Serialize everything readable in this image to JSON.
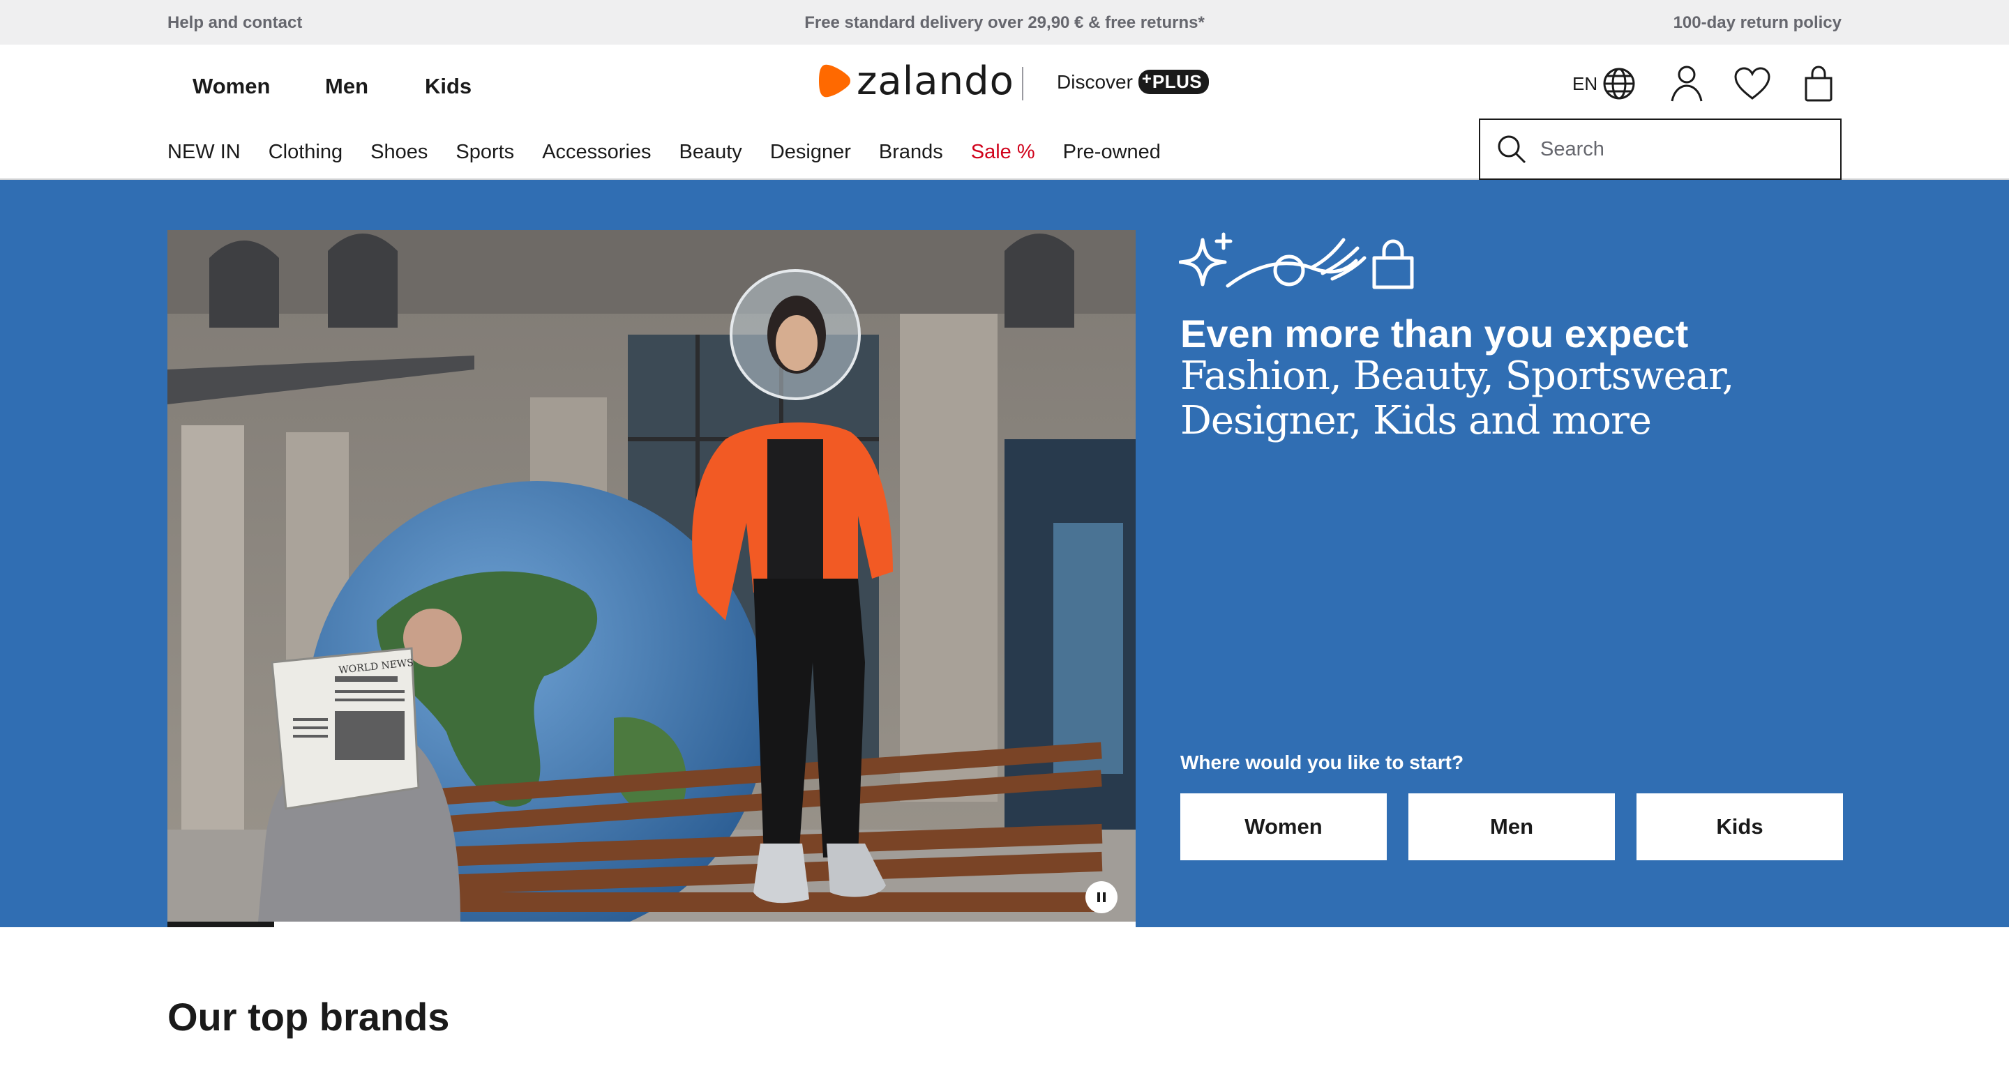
{
  "topbar": {
    "help": "Help and contact",
    "delivery": "Free standard delivery over 29,90 € & free returns*",
    "returns": "100-day return policy"
  },
  "header": {
    "genders": [
      "Women",
      "Men",
      "Kids"
    ],
    "logo_text": "zalando",
    "discover_label": "Discover",
    "plus_label": "PLUS",
    "language": "EN",
    "icons": [
      "globe-icon",
      "user-icon",
      "heart-icon",
      "bag-icon"
    ]
  },
  "categories": [
    "NEW IN",
    "Clothing",
    "Shoes",
    "Sports",
    "Accessories",
    "Beauty",
    "Designer",
    "Brands",
    "Sale %",
    "Pre-owned"
  ],
  "search": {
    "placeholder": "Search"
  },
  "hero": {
    "headline": "Even more than you expect",
    "subline": "Fashion, Beauty, Sportswear, Designer, Kids and more",
    "prompt": "Where would you like to start?",
    "buttons": [
      "Women",
      "Men",
      "Kids"
    ],
    "newspaper_title": "WORLD NEWS",
    "carousel_progress_fraction": 0.11,
    "background_color": "#306eb3"
  },
  "sections": {
    "top_brands": "Our top brands"
  },
  "colors": {
    "accent_orange": "#ff6900",
    "sale_red": "#d0021b",
    "hero_blue": "#306eb3"
  }
}
